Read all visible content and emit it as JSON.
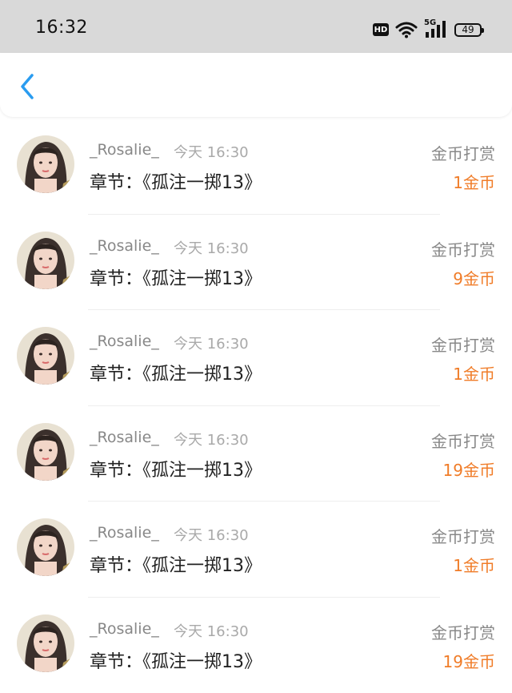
{
  "status_bar": {
    "time": "16:32",
    "hd_label": "HD",
    "network": "5G",
    "battery": "49"
  },
  "list": [
    {
      "name": "_Rosalie_",
      "time": "今天 16:30",
      "chapter": "章节：《孤注一掷13》",
      "reward_type": "金币打赏",
      "amount": "1金币"
    },
    {
      "name": "_Rosalie_",
      "time": "今天 16:30",
      "chapter": "章节：《孤注一掷13》",
      "reward_type": "金币打赏",
      "amount": "9金币"
    },
    {
      "name": "_Rosalie_",
      "time": "今天 16:30",
      "chapter": "章节：《孤注一掷13》",
      "reward_type": "金币打赏",
      "amount": "1金币"
    },
    {
      "name": "_Rosalie_",
      "time": "今天 16:30",
      "chapter": "章节：《孤注一掷13》",
      "reward_type": "金币打赏",
      "amount": "19金币"
    },
    {
      "name": "_Rosalie_",
      "time": "今天 16:30",
      "chapter": "章节：《孤注一掷13》",
      "reward_type": "金币打赏",
      "amount": "1金币"
    },
    {
      "name": "_Rosalie_",
      "time": "今天 16:30",
      "chapter": "章节：《孤注一掷13》",
      "reward_type": "金币打赏",
      "amount": "19金币"
    }
  ],
  "colors": {
    "status_bar_bg": "#d9d9d9",
    "back_icon": "#2a9cf0",
    "amount": "#f07c28",
    "secondary_text": "#888888"
  },
  "icons": {
    "back": "chevron-left-icon",
    "wifi": "wifi-icon",
    "signal": "signal-icon",
    "battery": "battery-icon"
  }
}
